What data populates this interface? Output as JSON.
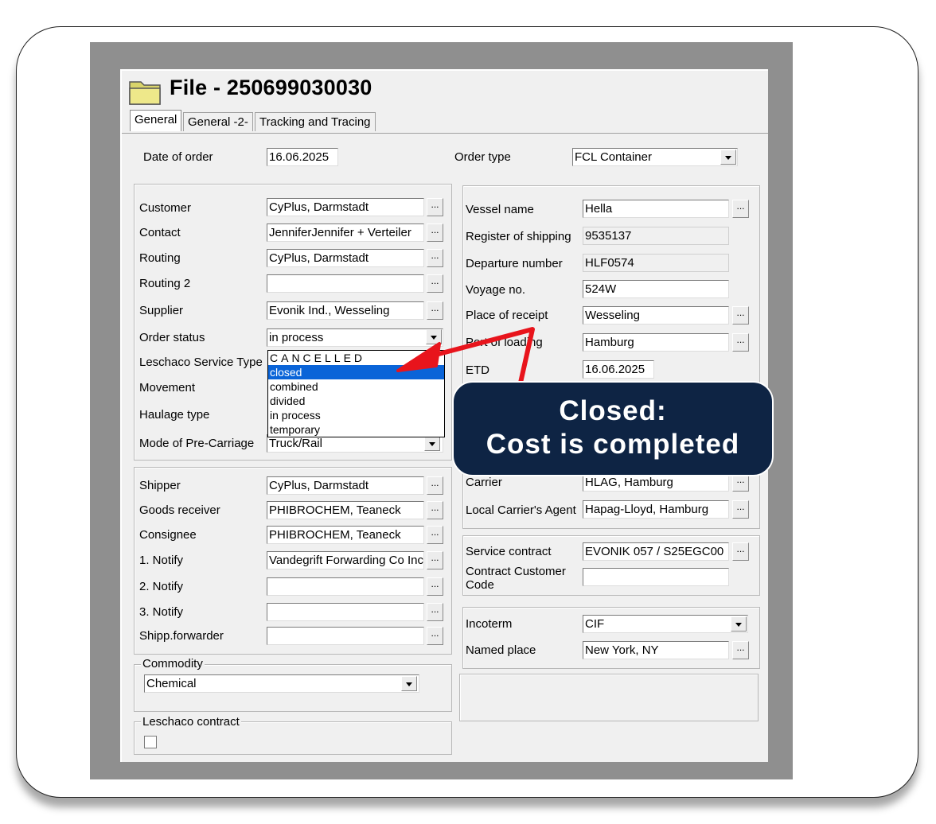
{
  "window": {
    "title": "File - 250699030030",
    "tabs": [
      "General",
      "General -2-",
      "Tracking and Tracing"
    ]
  },
  "order": {
    "date_label": "Date of order",
    "date_value": "16.06.2025",
    "type_label": "Order type",
    "type_value": "FCL Container"
  },
  "left_top": {
    "customer_label": "Customer",
    "customer_value": "CyPlus, Darmstadt",
    "contact_label": "Contact",
    "contact_value": "JenniferJennifer + Verteiler",
    "routing_label": "Routing",
    "routing_value": "CyPlus, Darmstadt",
    "routing2_label": "Routing 2",
    "routing2_value": "",
    "supplier_label": "Supplier",
    "supplier_value": "Evonik Ind., Wesseling",
    "status_label": "Order status",
    "status_value": "in process",
    "service_label": "Leschaco Service Type",
    "movement_label": "Movement",
    "haulage_label": "Haulage type",
    "precarriage_label": "Mode of Pre-Carriage",
    "precarriage_value": "Truck/Rail"
  },
  "status_options": [
    "CANCELLED",
    "closed",
    "combined",
    "divided",
    "in process",
    "temporary"
  ],
  "right_top": {
    "vessel_label": "Vessel name",
    "vessel_value": "Hella",
    "register_label": "Register of shipping",
    "register_value": "9535137",
    "departure_label": "Departure number",
    "departure_value": "HLF0574",
    "voyage_label": "Voyage no.",
    "voyage_value": "524W",
    "receipt_label": "Place of receipt",
    "receipt_value": "Wesseling",
    "loading_label": "Port of loading",
    "loading_value": "Hamburg",
    "etd_label": "ETD",
    "etd_value": "16.06.2025",
    "carrier_label": "Carrier",
    "carrier_value": "HLAG, Hamburg",
    "agent_label": "Local Carrier's Agent",
    "agent_value": "Hapag-Lloyd, Hamburg"
  },
  "left_mid": {
    "shipper_label": "Shipper",
    "shipper_value": "CyPlus, Darmstadt",
    "receiver_label": "Goods receiver",
    "receiver_value": "PHIBROCHEM, Teaneck",
    "consignee_label": "Consignee",
    "consignee_value": "PHIBROCHEM, Teaneck",
    "notify1_label": "1. Notify",
    "notify1_value": "Vandegrift Forwarding Co Inc",
    "notify2_label": "2. Notify",
    "notify2_value": "",
    "notify3_label": "3. Notify",
    "notify3_value": "",
    "forwarder_label": "Shipp.forwarder",
    "forwarder_value": ""
  },
  "contract": {
    "service_label": "Service contract",
    "service_value": "EVONIK 057 / S25EGC00",
    "customer_code_label_1": "Contract Customer",
    "customer_code_label_2": "Code",
    "customer_code_value": ""
  },
  "incoterm": {
    "incoterm_label": "Incoterm",
    "incoterm_value": "CIF",
    "place_label": "Named place",
    "place_value": "New York, NY"
  },
  "commodity": {
    "legend": "Commodity",
    "value": "Chemical"
  },
  "leschaco_contract": {
    "legend": "Leschaco contract"
  },
  "callout": {
    "line1": "Closed:",
    "line2": "Cost is completed"
  },
  "colors": {
    "callout_bg": "#0e2444",
    "arrow": "#e8141c",
    "selection": "#0a64d8"
  }
}
